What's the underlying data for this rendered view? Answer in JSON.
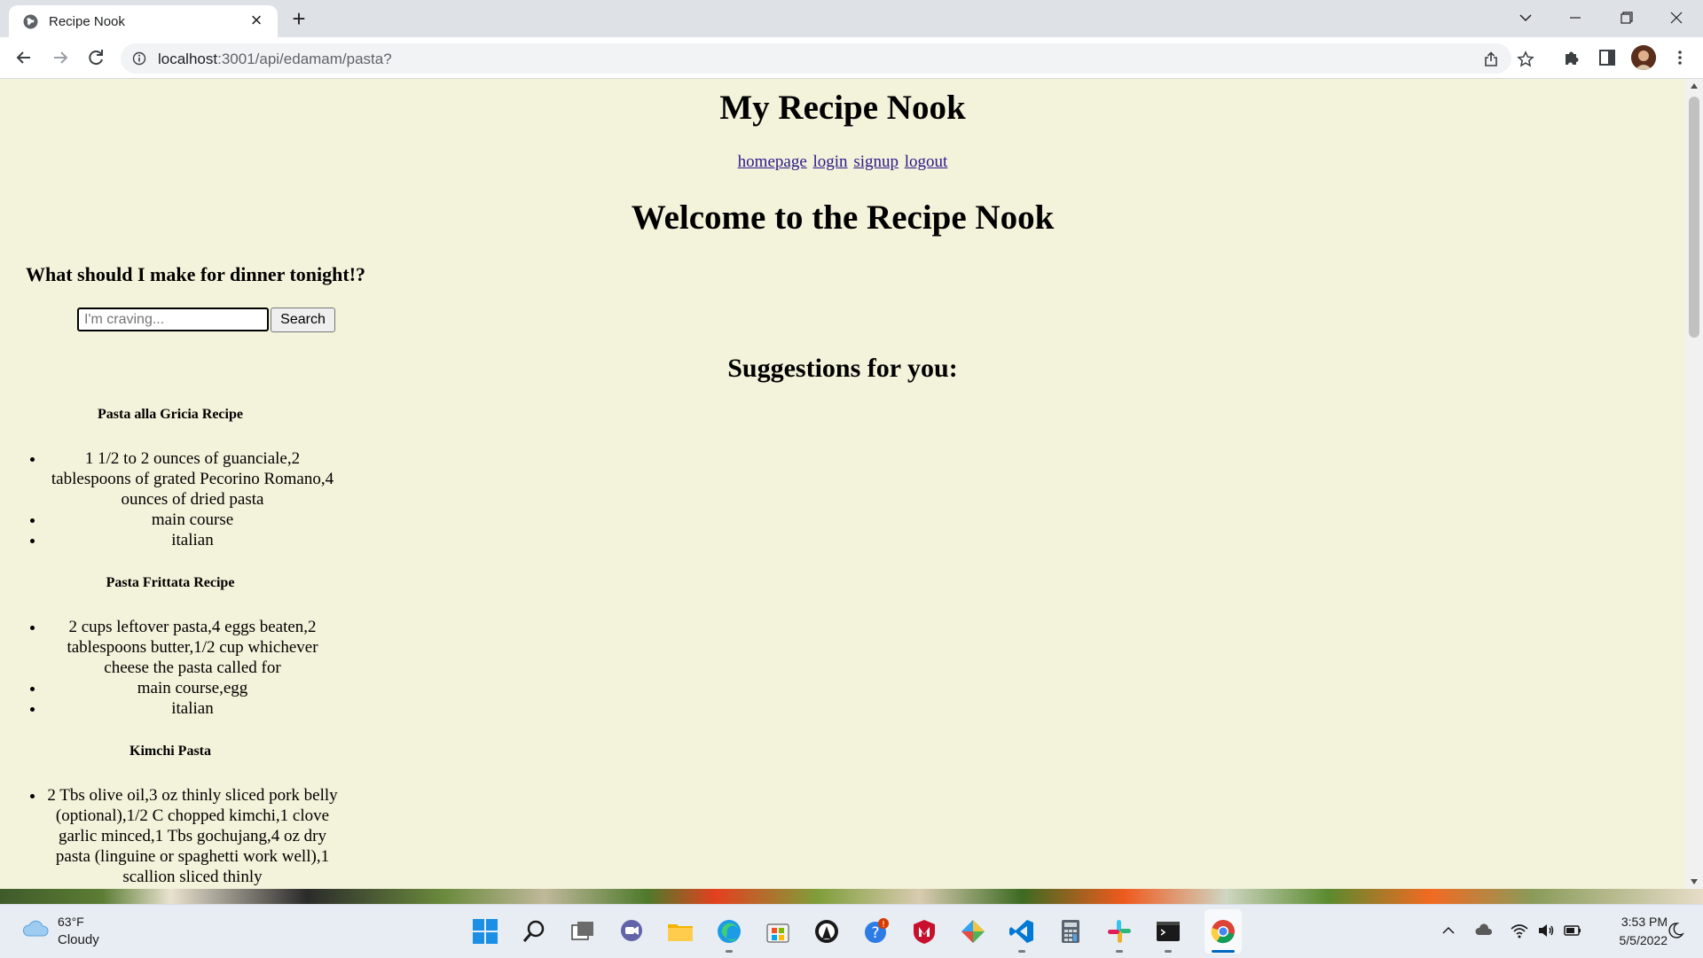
{
  "browser": {
    "tab_title": "Recipe Nook",
    "url_host": "localhost",
    "url_path": ":3001/api/edamam/pasta?"
  },
  "page": {
    "site_title": "My Recipe Nook",
    "nav": [
      "homepage",
      "login",
      "signup",
      "logout"
    ],
    "welcome": "Welcome to the Recipe Nook",
    "question": "What should I make for dinner tonight!?",
    "search_placeholder": "I'm craving...",
    "search_button": "Search",
    "suggestions_heading": "Suggestions for you:",
    "recipes": [
      {
        "title": "Pasta alla Gricia Recipe",
        "ingredients": "1 1/2 to 2 ounces of guanciale,2 tablespoons of grated Pecorino Romano,4 ounces of dried pasta",
        "meal_type": "main course",
        "cuisine": "italian"
      },
      {
        "title": "Pasta Frittata Recipe",
        "ingredients": "2 cups leftover pasta,4 eggs beaten,2 tablespoons butter,1/2 cup whichever cheese the pasta called for",
        "meal_type": "main course,egg",
        "cuisine": "italian"
      },
      {
        "title": "Kimchi Pasta",
        "ingredients": "2 Tbs olive oil,3 oz thinly sliced pork belly (optional),1/2 C chopped kimchi,1 clove garlic minced,1 Tbs gochujang,4 oz dry pasta (linguine or spaghetti work well),1 scallion sliced thinly"
      }
    ]
  },
  "taskbar": {
    "weather_temp": "63°F",
    "weather_condition": "Cloudy",
    "time": "3:53 PM",
    "date": "5/5/2022"
  },
  "colors": {
    "page_background": "#f3f2da",
    "link": "#2a1a8c"
  }
}
